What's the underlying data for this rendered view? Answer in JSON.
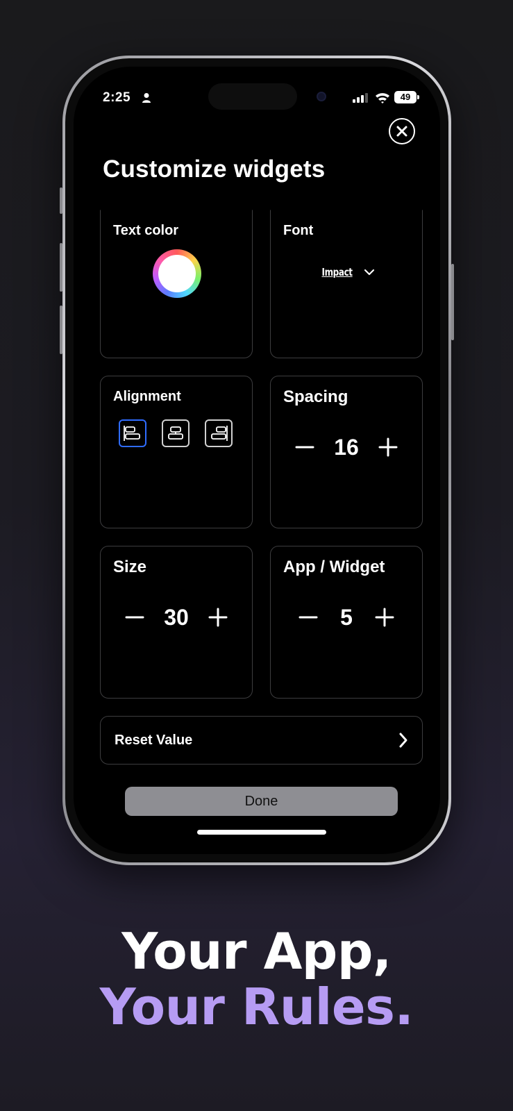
{
  "status_bar": {
    "time": "2:25",
    "battery": "49"
  },
  "screen": {
    "title": "Customize widgets",
    "cards": {
      "text_color": {
        "label": "Text color"
      },
      "font": {
        "label": "Font",
        "value": "Impact"
      },
      "alignment": {
        "label": "Alignment",
        "options": [
          "left",
          "center",
          "right"
        ],
        "selected": "left"
      },
      "spacing": {
        "label": "Spacing",
        "value": "16"
      },
      "size": {
        "label": "Size",
        "value": "30"
      },
      "apps_per_widget": {
        "label": "App / Widget",
        "value": "5"
      }
    },
    "reset_label": "Reset Value",
    "done_label": "Done"
  },
  "tagline": {
    "line1": "Your App,",
    "line2": "Your Rules."
  },
  "colors": {
    "accent": "#b69cf3",
    "selected_alignment": "#2f6cff",
    "done_button": "#8e8e93"
  }
}
